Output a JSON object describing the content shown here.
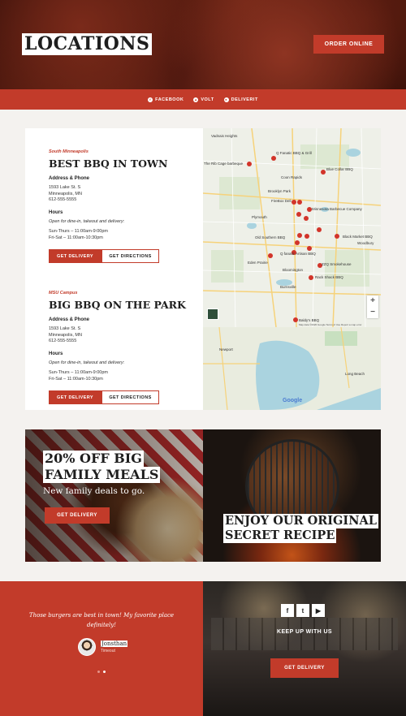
{
  "hero": {
    "title": "LOCATIONS",
    "order_button": "ORDER ONLINE"
  },
  "delivery_bar": {
    "links": [
      {
        "label": "FACEBOOK",
        "icon": "facebook-icon"
      },
      {
        "label": "VOLT",
        "icon": "volt-icon"
      },
      {
        "label": "DELIVERIT",
        "icon": "deliverit-icon"
      }
    ]
  },
  "locations": [
    {
      "area": "South Minneapolis",
      "name": "BEST BBQ IN TOWN",
      "address_heading": "Address & Phone",
      "address": [
        "1593 Lake St. S",
        "Minneapolis, MN",
        "612-555-5555"
      ],
      "hours_heading": "Hours",
      "hours_note": "Open for dine-in, takeout and delivery:",
      "hours": [
        "Sun-Thurs – 11:00am-9:00pm",
        "Fri-Sat – 11:00am-10:30pm"
      ],
      "delivery_button": "GET DELIVERY",
      "directions_button": "GET DIRECTIONS"
    },
    {
      "area": "MSU Campus",
      "name": "BIG BBQ ON THE PARK",
      "address_heading": "Address & Phone",
      "address": [
        "1593 Lake St. S",
        "Minneapolis, MN",
        "612-555-5555"
      ],
      "hours_heading": "Hours",
      "hours_note": "Open for dine-in, takeout and delivery:",
      "hours": [
        "Sun-Thurs – 11:00am-9:00pm",
        "Fri-Sat – 11:00am-10:30pm"
      ],
      "delivery_button": "GET DELIVERY",
      "directions_button": "GET DIRECTIONS"
    }
  ],
  "map": {
    "places": [
      "Vadnais Heights",
      "Q Fanatic BBQ & Grill",
      "The Rib Cage barbeque",
      "Coon Rapids",
      "Blue Collar BBQ",
      "Brooklyn Park",
      "FireBox Deli",
      "Minnesota Barbecue Company",
      "Plymouth",
      "Old Southern BBQ",
      "Black Market BBQ",
      "Woodbury",
      "Eden Prairie",
      "Q fanatic Artisan BBQ",
      "ZZQ Smokehouse",
      "Bloomington",
      "Rack Shack BBQ",
      "Burnsville",
      "Baldy's BBQ",
      "Newport",
      "Long Beach",
      "Google"
    ],
    "zoom_in": "+",
    "zoom_out": "−",
    "terms": "Map data ©2020 Google   Terms of Use   Report a map error"
  },
  "promo_left": {
    "title_lines": [
      "20% OFF BIG",
      "FAMILY MEALS"
    ],
    "subtitle": "New family deals to go.",
    "button": "GET DELIVERY"
  },
  "promo_right": {
    "title_lines": [
      "ENJOY OUR ORIGINAL",
      "SECRET RECIPE"
    ]
  },
  "testimonial": {
    "quote": "Those burgers are best in town! My favorite place definitely!",
    "author": "Jonsthan",
    "source": "Timeout"
  },
  "social": {
    "icons": [
      {
        "name": "facebook-icon",
        "glyph": "f"
      },
      {
        "name": "twitter-icon",
        "glyph": "t"
      },
      {
        "name": "youtube-icon",
        "glyph": "▶"
      }
    ],
    "heading": "KEEP UP WITH US",
    "button": "GET DELIVERY"
  },
  "colors": {
    "accent": "#c23b2a",
    "dark": "#1e1e1e"
  }
}
